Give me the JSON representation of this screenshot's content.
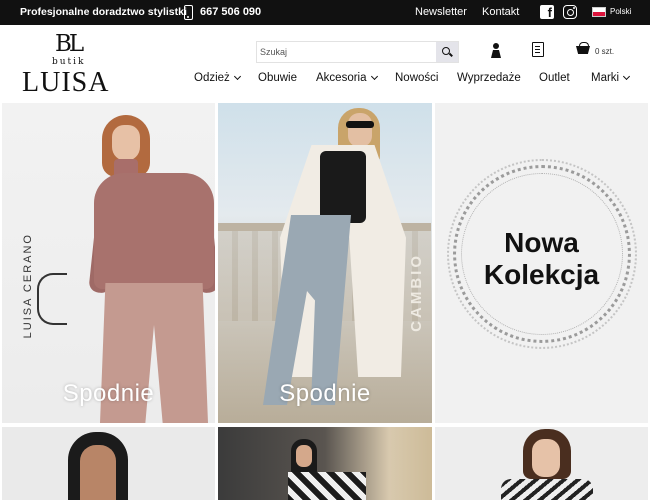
{
  "topbar": {
    "promo": "Profesjonalne doradztwo stylistki",
    "phone": "667 506 090",
    "newsletter": "Newsletter",
    "contact": "Kontakt",
    "language": "Polski"
  },
  "header": {
    "logo_monogram": "BL",
    "logo_sub": "butik",
    "logo_name": "LUISA",
    "search_placeholder": "Szukaj",
    "cart_count": "0 szt."
  },
  "nav": {
    "items": [
      {
        "label": "Odzież",
        "dropdown": true
      },
      {
        "label": "Obuwie",
        "dropdown": false
      },
      {
        "label": "Akcesoria",
        "dropdown": true
      },
      {
        "label": "Nowości",
        "dropdown": false
      },
      {
        "label": "Wyprzedaże",
        "dropdown": false
      },
      {
        "label": "Outlet",
        "dropdown": false
      },
      {
        "label": "Marki",
        "dropdown": true
      }
    ]
  },
  "tiles": {
    "t1": {
      "caption": "Spodnie",
      "brand": "LUISA CERANO"
    },
    "t2": {
      "caption": "Spodnie",
      "brand": "CAMBIO"
    },
    "t3": {
      "line1": "Nowa",
      "line2": "Kolekcja"
    }
  },
  "colors": {
    "topbar_bg": "#111111",
    "accent": "#111111",
    "flag_white": "#ffffff",
    "flag_red": "#dc143c"
  },
  "icons": [
    "phone-icon",
    "facebook-icon",
    "instagram-icon",
    "flag-pl-icon",
    "search-icon",
    "user-icon",
    "document-icon",
    "cart-icon",
    "chevron-down-icon"
  ]
}
